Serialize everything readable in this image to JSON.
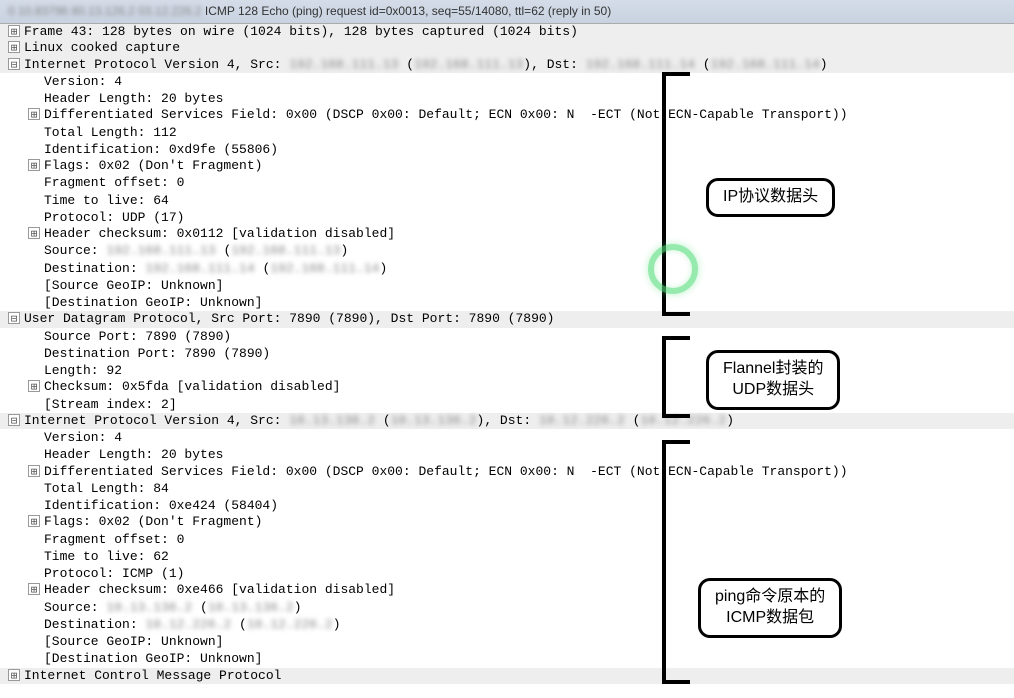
{
  "header": {
    "blur_prefix": "0 10.83796 80.13.126.2 03.12.226.2",
    "text": " ICMP 128 Echo (ping) request  id=0x0013, seq=55/14080, ttl=62 (reply in 50)"
  },
  "rows": [
    {
      "exp": "+",
      "shaded": true,
      "indent": 0,
      "text": "Frame 43: 128 bytes on wire (1024 bits), 128 bytes captured (1024 bits)"
    },
    {
      "exp": "+",
      "shaded": true,
      "indent": 0,
      "text": "Linux cooked capture"
    },
    {
      "exp": "-",
      "shaded": true,
      "indent": 0,
      "text": "Internet Protocol Version 4, Src: ",
      "blur1": "192.168.111.13",
      "text2": " (",
      "blur2": "192.168.111.13",
      "text3": "), Dst: ",
      "blur3": "192.168.111.14",
      "text4": " (",
      "blur4": "192.168.111.14",
      "text5": ")"
    },
    {
      "exp": "",
      "shaded": false,
      "indent": 1,
      "text": "Version: 4"
    },
    {
      "exp": "",
      "shaded": false,
      "indent": 1,
      "text": "Header Length: 20 bytes"
    },
    {
      "exp": "+",
      "shaded": false,
      "indent": 1,
      "text": "Differentiated Services Field: 0x00 (DSCP 0x00: Default; ECN 0x00: N  -ECT (Not ECN-Capable Transport))"
    },
    {
      "exp": "",
      "shaded": false,
      "indent": 1,
      "text": "Total Length: 112"
    },
    {
      "exp": "",
      "shaded": false,
      "indent": 1,
      "text": "Identification: 0xd9fe (55806)"
    },
    {
      "exp": "+",
      "shaded": false,
      "indent": 1,
      "text": "Flags: 0x02 (Don't Fragment)"
    },
    {
      "exp": "",
      "shaded": false,
      "indent": 1,
      "text": "Fragment offset: 0"
    },
    {
      "exp": "",
      "shaded": false,
      "indent": 1,
      "text": "Time to live: 64"
    },
    {
      "exp": "",
      "shaded": false,
      "indent": 1,
      "text": "Protocol: UDP (17)"
    },
    {
      "exp": "+",
      "shaded": false,
      "indent": 1,
      "text": "Header checksum: 0x0112 [validation disabled]"
    },
    {
      "exp": "",
      "shaded": false,
      "indent": 1,
      "text": "Source: ",
      "blur1": "192.168.111.13",
      "text2": " (",
      "blur2": "192.168.111.13",
      "text3": ")"
    },
    {
      "exp": "",
      "shaded": false,
      "indent": 1,
      "text": "Destination: ",
      "blur1": "192.168.111.14",
      "text2": " (",
      "blur2": "192.168.111.14",
      "text3": ")"
    },
    {
      "exp": "",
      "shaded": false,
      "indent": 1,
      "text": "[Source GeoIP: Unknown]"
    },
    {
      "exp": "",
      "shaded": false,
      "indent": 1,
      "text": "[Destination GeoIP: Unknown]"
    },
    {
      "exp": "-",
      "shaded": true,
      "indent": 0,
      "text": "User Datagram Protocol, Src Port: 7890 (7890), Dst Port: 7890 (7890)"
    },
    {
      "exp": "",
      "shaded": false,
      "indent": 1,
      "text": "Source Port: 7890 (7890)"
    },
    {
      "exp": "",
      "shaded": false,
      "indent": 1,
      "text": "Destination Port: 7890 (7890)"
    },
    {
      "exp": "",
      "shaded": false,
      "indent": 1,
      "text": "Length: 92"
    },
    {
      "exp": "+",
      "shaded": false,
      "indent": 1,
      "text": "Checksum: 0x5fda [validation disabled]"
    },
    {
      "exp": "",
      "shaded": false,
      "indent": 1,
      "text": "[Stream index: 2]"
    },
    {
      "exp": "-",
      "shaded": true,
      "indent": 0,
      "text": "Internet Protocol Version 4, Src: ",
      "blur1": "10.13.136.2",
      "text2": " (",
      "blur2": "10.13.136.2",
      "text3": "), Dst: ",
      "blur3": "10.12.226.2",
      "text4": " (",
      "blur4": "10.12.226.2",
      "text5": ")"
    },
    {
      "exp": "",
      "shaded": false,
      "indent": 1,
      "text": "Version: 4"
    },
    {
      "exp": "",
      "shaded": false,
      "indent": 1,
      "text": "Header Length: 20 bytes"
    },
    {
      "exp": "+",
      "shaded": false,
      "indent": 1,
      "text": "Differentiated Services Field: 0x00 (DSCP 0x00: Default; ECN 0x00: N  -ECT (Not ECN-Capable Transport))"
    },
    {
      "exp": "",
      "shaded": false,
      "indent": 1,
      "text": "Total Length: 84"
    },
    {
      "exp": "",
      "shaded": false,
      "indent": 1,
      "text": "Identification: 0xe424 (58404)"
    },
    {
      "exp": "+",
      "shaded": false,
      "indent": 1,
      "text": "Flags: 0x02 (Don't Fragment)"
    },
    {
      "exp": "",
      "shaded": false,
      "indent": 1,
      "text": "Fragment offset: 0"
    },
    {
      "exp": "",
      "shaded": false,
      "indent": 1,
      "text": "Time to live: 62"
    },
    {
      "exp": "",
      "shaded": false,
      "indent": 1,
      "text": "Protocol: ICMP (1)"
    },
    {
      "exp": "+",
      "shaded": false,
      "indent": 1,
      "text": "Header checksum: 0xe466 [validation disabled]"
    },
    {
      "exp": "",
      "shaded": false,
      "indent": 1,
      "text": "Source: ",
      "blur1": "10.13.136.2",
      "text2": " (",
      "blur2": "10.13.136.2",
      "text3": ")"
    },
    {
      "exp": "",
      "shaded": false,
      "indent": 1,
      "text": "Destination: ",
      "blur1": "10.12.226.2",
      "text2": " (",
      "blur2": "10.12.226.2",
      "text3": ")"
    },
    {
      "exp": "",
      "shaded": false,
      "indent": 1,
      "text": "[Source GeoIP: Unknown]"
    },
    {
      "exp": "",
      "shaded": false,
      "indent": 1,
      "text": "[Destination GeoIP: Unknown]"
    },
    {
      "exp": "+",
      "shaded": true,
      "indent": 0,
      "text": "Internet Control Message Protocol"
    }
  ],
  "annotations": {
    "label1": "IP协议数据头",
    "label2_line1": "Flannel封装的",
    "label2_line2": "UDP数据头",
    "label3_line1": "ping命令原本的",
    "label3_line2": "ICMP数据包"
  }
}
